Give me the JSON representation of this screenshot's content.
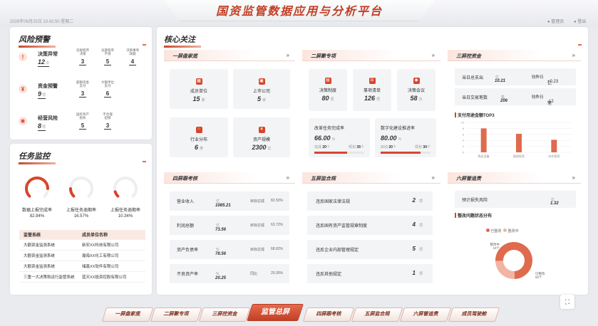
{
  "header": {
    "title": "国资监管数据应用与分析平台",
    "datetime": "2026年06月25日 10:42:50 星期二",
    "actions": [
      {
        "icon": "settings-icon",
        "label": "管理员"
      },
      {
        "icon": "logout-icon",
        "label": "登出"
      }
    ]
  },
  "risk": {
    "title": "风险预警",
    "rows": [
      {
        "name": "决策异常",
        "value": "12",
        "unit": "次",
        "subs": [
          {
            "label": "违规程序\n决策",
            "value": "3"
          },
          {
            "label": "议题程序\n不清",
            "value": "5"
          },
          {
            "label": "决策事项\n缺漏",
            "value": "4"
          }
        ]
      },
      {
        "name": "资金预警",
        "value": "9",
        "unit": "项",
        "subs": [
          {
            "label": "超额资金\n支付",
            "value": "3"
          },
          {
            "label": "大额单位\n支付",
            "value": "6"
          }
        ]
      },
      {
        "name": "经营风险",
        "value": "8",
        "unit": "项",
        "subs": [
          {
            "label": "国有资产\n损失",
            "value": "5"
          },
          {
            "label": "不合理\n担保",
            "value": "3"
          }
        ]
      }
    ]
  },
  "task": {
    "title": "任务监控",
    "rings": [
      {
        "label": "数据上报完成率",
        "value": "82.94%",
        "fraction": 0.8294
      },
      {
        "label": "上报任务逾期率",
        "value": "16.57%",
        "fraction": 0.1657
      },
      {
        "label": "上报任务逾期率",
        "value": "10.34%",
        "fraction": 0.1034
      }
    ],
    "table": {
      "headers": [
        "监管系统",
        "成员单位名称"
      ],
      "rows": [
        [
          "大额资金监测系统",
          "新安XX科技有限公司"
        ],
        [
          "大额资金监测系统",
          "瀚海XX化工有限公司"
        ],
        [
          "大额资金监测系统",
          "储鑫XX软件有限公司"
        ],
        [
          "三重一大决策和运行监管系统",
          "蓝天XX投资控股有限公司"
        ]
      ]
    }
  },
  "core": {
    "title": "核心关注",
    "screen1": {
      "title": "一屏盘家底",
      "more": "»",
      "items": [
        {
          "label": "成员单位",
          "value": "15",
          "unit": "家"
        },
        {
          "label": "上市公司",
          "value": "5",
          "unit": "家"
        },
        {
          "label": "行业分布",
          "value": "6",
          "unit": "类"
        },
        {
          "label": "资产规模",
          "value": "2300",
          "unit": "亿"
        }
      ]
    },
    "screen2": {
      "title": "二屏聚专项",
      "more": "»",
      "items": [
        {
          "label": "决策制度",
          "value": "80",
          "unit": "项"
        },
        {
          "label": "事项清单",
          "value": "126",
          "unit": "项"
        },
        {
          "label": "决策会议",
          "value": "58",
          "unit": "次"
        }
      ],
      "progress": [
        {
          "label": "改革任务完成率",
          "value": "66.00",
          "unit": "%",
          "done_label": "完成",
          "done": "20",
          "unit2": "个",
          "plan_label": "规划",
          "plan": "35",
          "fraction": 0.66
        },
        {
          "label": "数字化建设推进率",
          "value": "80.00",
          "unit": "%",
          "done_label": "启动",
          "done": "20",
          "unit2": "个",
          "plan_label": "规划",
          "plan": "30",
          "fraction": 0.8
        }
      ]
    },
    "screen3": {
      "title": "三屏控资金",
      "more": "»",
      "stats": [
        {
          "label": "当日总支出",
          "value": "10.21",
          "unit": "亿",
          "cmp_label": "较昨日",
          "cmp": "+0.23",
          "cmp_unit": "亿",
          "cmp_color": "#3aa55c"
        },
        {
          "label": "当日交易笔数",
          "value": "206",
          "unit": "笔",
          "cmp_label": "较昨日",
          "cmp": "-12",
          "cmp_unit": "笔",
          "cmp_color": "#d8452a"
        }
      ],
      "chart_title": "支付用途金额TOP3"
    },
    "screen4": {
      "title": "四屏跟考核",
      "more": "»",
      "rows": [
        {
          "label": "营业收入",
          "value": "1085.21",
          "unit": "亿",
          "k": "目标达成",
          "pct": "82.50%"
        },
        {
          "label": "利润总额",
          "value": "73.56",
          "unit": "亿",
          "k": "目标达成",
          "pct": "63.72%"
        },
        {
          "label": "资产负债率",
          "value": "78.56",
          "unit": "%",
          "k": "目标达成",
          "pct": "68.82%"
        },
        {
          "label": "不良资产率",
          "value": "20.25",
          "unit": "%",
          "k": "同比",
          "pct": "25.00%"
        }
      ]
    },
    "screen5": {
      "title": "五屏监合规",
      "more": "»",
      "rows": [
        {
          "label": "违反国家法律法规",
          "value": "2",
          "unit": "项"
        },
        {
          "label": "违反国有资产监管规章制度",
          "value": "4",
          "unit": "项"
        },
        {
          "label": "违反企业内部管理规定",
          "value": "5",
          "unit": "项"
        },
        {
          "label": "违反其他规定",
          "value": "1",
          "unit": "项"
        }
      ]
    },
    "screen6": {
      "title": "六屏管追责",
      "more": "»",
      "loss_label": "预计损失风险",
      "loss_value": "1.32",
      "loss_unit": "亿",
      "chart_title": "整改问题状态分布",
      "legend": [
        "已整改",
        "整改中"
      ]
    }
  },
  "chart_data": [
    {
      "type": "bar",
      "title": "支付用途金额TOP3",
      "categories": [
        "购买设备",
        "股权投资",
        "对外投资"
      ],
      "values": [
        8,
        6.2,
        4.2
      ],
      "ylim": [
        0,
        10
      ],
      "yticks": [
        "0",
        "2",
        "4",
        "6",
        "8",
        "10"
      ],
      "colors": [
        "#e06a4e"
      ]
    },
    {
      "type": "pie",
      "title": "整改问题状态分布",
      "labels": [
        "已整改",
        "整改中"
      ],
      "values": [
        56,
        19
      ],
      "slice_labels": [
        "已整改\n56个",
        "整改中\n19个"
      ],
      "colors": [
        "#e06a4e",
        "#f2b4a4"
      ]
    }
  ],
  "tabs": [
    "一屏盘家底",
    "二屏聚专项",
    "三屏控资金",
    "监管总屏",
    "四屏跟考核",
    "五屏监合规",
    "六屏管追责",
    "成员驾驶舱"
  ],
  "active_tab": "监管总屏",
  "fab": {
    "icon": "fullscreen-icon"
  }
}
